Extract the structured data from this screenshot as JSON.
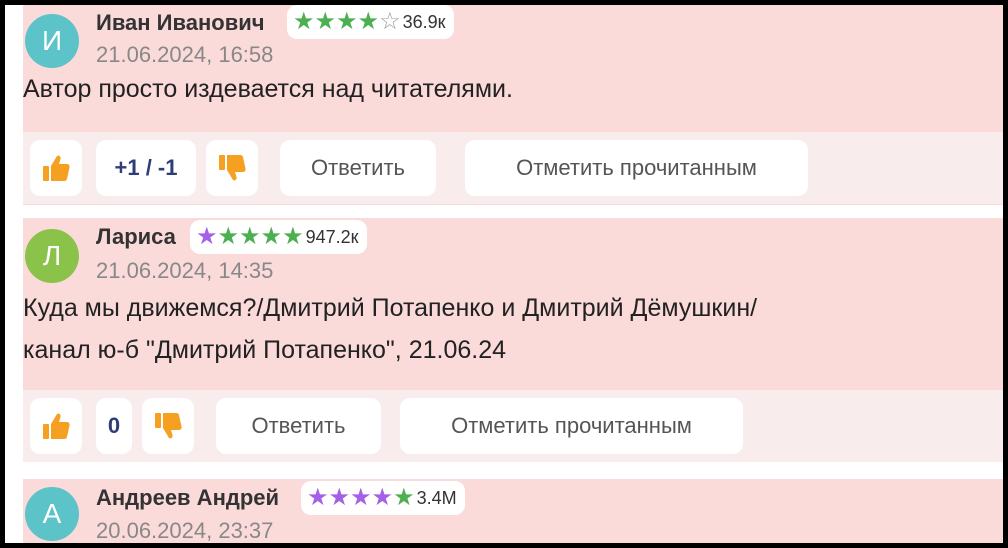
{
  "colors": {
    "comment_bg": "#fbdada",
    "actions_bg": "#f8ecec",
    "thumb": "#f5a020",
    "star_green": "#4caf50",
    "star_purple": "#a560e8"
  },
  "comments": [
    {
      "avatar_letter": "И",
      "avatar_color": "#5cc3c9",
      "author": "Иван Иванович",
      "rating_stars": 4,
      "rating_value": "36.9к",
      "date": "21.06.2024, 16:58",
      "text_lines": [
        "Автор просто издевается над читателями."
      ],
      "votes": "+1 / -1",
      "reply_label": "Ответить",
      "mark_read_label": "Отметить прочитанным"
    },
    {
      "avatar_letter": "Л",
      "avatar_color": "#8bc34a",
      "author": "Лариса",
      "rating_stars": 5,
      "rating_value": "947.2к",
      "date": "21.06.2024, 14:35",
      "text_lines": [
        "Куда мы движемся?/Дмитрий Потапенко и Дмитрий Дёмушкин/",
        "канал ю-б \"Дмитрий Потапенко\", 21.06.24"
      ],
      "votes": "0",
      "reply_label": "Ответить",
      "mark_read_label": "Отметить прочитанным"
    },
    {
      "avatar_letter": "А",
      "avatar_color": "#5cc3c9",
      "author": "Андреев Андрей",
      "rating_stars": 5,
      "rating_value": "3.4M",
      "date": "20.06.2024, 23:37"
    }
  ],
  "icons": {
    "thumb_up": "thumbs-up-icon",
    "thumb_down": "thumbs-down-icon",
    "star": "star-icon"
  }
}
